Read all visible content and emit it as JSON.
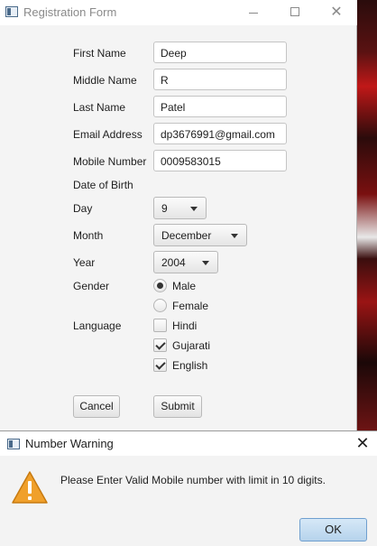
{
  "window": {
    "title": "Registration Form",
    "minimize_icon": "minimize-icon",
    "maximize_icon": "maximize-icon",
    "close_icon": "close-icon"
  },
  "form": {
    "first_name": {
      "label": "First Name",
      "value": "Deep"
    },
    "middle_name": {
      "label": "Middle Name",
      "value": "R"
    },
    "last_name": {
      "label": "Last Name",
      "value": "Patel"
    },
    "email": {
      "label": "Email Address",
      "value": "dp3676991@gmail.com"
    },
    "mobile": {
      "label": "Mobile Number",
      "value": "0009583015"
    },
    "dob_label": "Date of Birth",
    "day": {
      "label": "Day",
      "value": "9"
    },
    "month": {
      "label": "Month",
      "value": "December"
    },
    "year": {
      "label": "Year",
      "value": "2004"
    },
    "gender": {
      "label": "Gender",
      "options": [
        "Male",
        "Female"
      ],
      "selected": "Male"
    },
    "language": {
      "label": "Language",
      "options": [
        {
          "label": "Hindi",
          "checked": false
        },
        {
          "label": "Gujarati",
          "checked": true
        },
        {
          "label": "English",
          "checked": true
        }
      ]
    },
    "cancel_label": "Cancel",
    "submit_label": "Submit"
  },
  "dialog": {
    "title": "Number Warning",
    "message": "Please Enter Valid Mobile number with limit in 10 digits.",
    "ok_label": "OK",
    "icon": "warning-icon"
  },
  "colors": {
    "warning_fill": "#f0a02b",
    "ok_button": "#b6d3ec"
  }
}
